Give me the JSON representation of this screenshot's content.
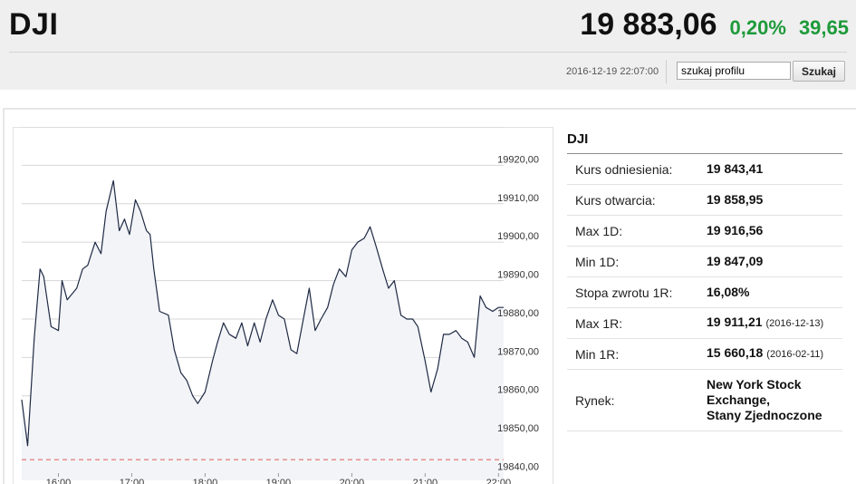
{
  "header": {
    "symbol": "DJI",
    "price": "19 883,06",
    "change_percent": "0,20%",
    "change_value": "39,65",
    "change_color": "#1e9a3a",
    "timestamp": "2016-12-19 22:07:00",
    "search": {
      "value": "szukaj profilu",
      "button_label": "Szukaj"
    }
  },
  "chart_data": {
    "type": "area",
    "title": "",
    "xlabel": "",
    "ylabel": "",
    "x_ticks": [
      "16:00",
      "17:00",
      "18:00",
      "19:00",
      "20:00",
      "21:00",
      "22:00"
    ],
    "y_ticks": [
      "19920,00",
      "19910,00",
      "19900,00",
      "19890,00",
      "19880,00",
      "19870,00",
      "19860,00",
      "19850,00",
      "19840,00"
    ],
    "ylim": [
      19838,
      19930
    ],
    "xlim": [
      15.5,
      22.07
    ],
    "y_axis_position": "right",
    "grid": "horizontal",
    "reference_level": 19843.41,
    "line_color": "#1f2a44",
    "fill_color": "#f2f4f7",
    "reference_color": "#e05a5a",
    "series": [
      {
        "x": [
          15.5,
          15.58,
          15.67,
          15.75,
          15.8,
          15.9,
          16.0,
          16.05,
          16.12,
          16.25,
          16.33,
          16.4,
          16.5,
          16.58,
          16.65,
          16.75,
          16.83,
          16.9,
          16.97,
          17.05,
          17.12,
          17.2,
          17.25,
          17.3,
          17.38,
          17.5,
          17.58,
          17.67,
          17.75,
          17.83,
          17.9,
          18.0,
          18.1,
          18.17,
          18.25,
          18.33,
          18.42,
          18.5,
          18.58,
          18.67,
          18.75,
          18.83,
          18.92,
          19.0,
          19.08,
          19.17,
          19.25,
          19.33,
          19.42,
          19.5,
          19.58,
          19.67,
          19.75,
          19.83,
          19.92,
          20.0,
          20.08,
          20.17,
          20.25,
          20.33,
          20.42,
          20.5,
          20.58,
          20.67,
          20.75,
          20.83,
          20.9,
          21.0,
          21.08,
          21.17,
          21.25,
          21.33,
          21.42,
          21.5,
          21.58,
          21.67,
          21.75,
          21.83,
          21.92,
          22.0,
          22.07
        ],
        "y": [
          19859,
          19847,
          19875,
          19893,
          19891,
          19878,
          19877,
          19890,
          19885,
          19888,
          19893,
          19894,
          19900,
          19897,
          19908,
          19916,
          19903,
          19906,
          19902,
          19911,
          19908,
          19903,
          19902,
          19893,
          19882,
          19881,
          19872,
          19866,
          19864,
          19860,
          19858,
          19861,
          19869,
          19874,
          19879,
          19876,
          19875,
          19879,
          19873,
          19879,
          19874,
          19880,
          19885,
          19881,
          19880,
          19872,
          19871,
          19879,
          19888,
          19877,
          19880,
          19883,
          19889,
          19893,
          19891,
          19898,
          19900,
          19901,
          19904,
          19899,
          19893,
          19888,
          19890,
          19881,
          19880,
          19880,
          19878,
          19869,
          19861,
          19867,
          19876,
          19876,
          19877,
          19875,
          19874,
          19870,
          19886,
          19883,
          19882,
          19883,
          19883
        ]
      }
    ]
  },
  "info": {
    "title": "DJI",
    "rows": [
      {
        "label": "Kurs odniesienia:",
        "value": "19 843,41",
        "date": ""
      },
      {
        "label": "Kurs otwarcia:",
        "value": "19 858,95",
        "date": ""
      },
      {
        "label": "Max 1D:",
        "value": "19 916,56",
        "date": ""
      },
      {
        "label": "Min 1D:",
        "value": "19 847,09",
        "date": ""
      },
      {
        "label": "Stopa zwrotu 1R:",
        "value": "16,08%",
        "date": ""
      },
      {
        "label": "Max 1R:",
        "value": "19 911,21",
        "date": "(2016-12-13)"
      },
      {
        "label": "Min 1R:",
        "value": "15 660,18",
        "date": "(2016-02-11)"
      }
    ],
    "market": {
      "label": "Rynek:",
      "lines": [
        "New York Stock",
        "Exchange,",
        "Stany Zjednoczone"
      ]
    }
  }
}
